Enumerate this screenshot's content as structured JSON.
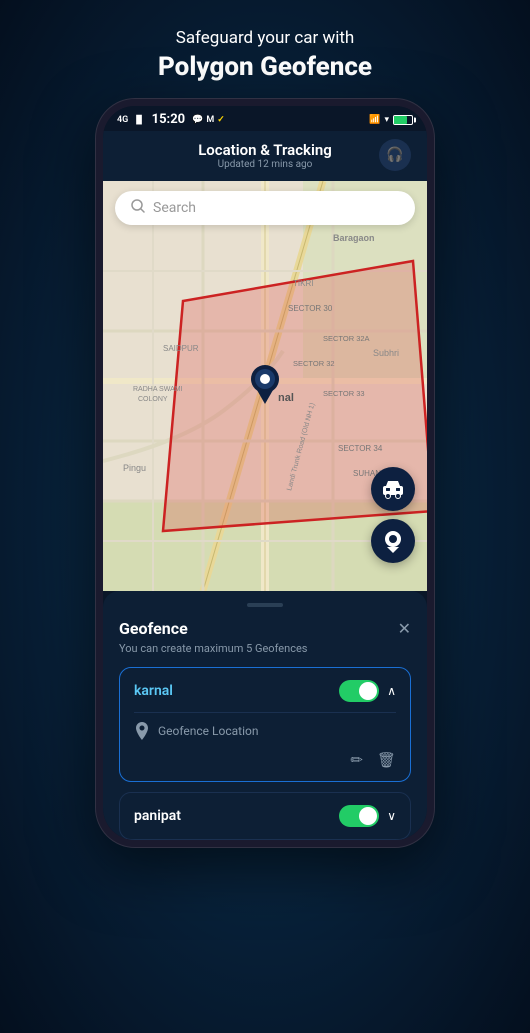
{
  "headline": {
    "sub": "Safeguard your car with",
    "main": "Polygon Geofence"
  },
  "statusBar": {
    "time": "15:20",
    "signal": "4G"
  },
  "appHeader": {
    "title": "Location & Tracking",
    "subtitle": "Updated 12 mins ago"
  },
  "search": {
    "placeholder": "Search"
  },
  "mapButtons": {
    "carIcon": "🚗",
    "pinIcon": "📍"
  },
  "panel": {
    "title": "Geofence",
    "subtitle": "You can create maximum 5 Geofences",
    "closeIcon": "✕"
  },
  "geofences": [
    {
      "name": "karnal",
      "active": true,
      "expanded": true,
      "locationLabel": "Geofence Location"
    },
    {
      "name": "panipat",
      "active": true,
      "expanded": false
    }
  ]
}
